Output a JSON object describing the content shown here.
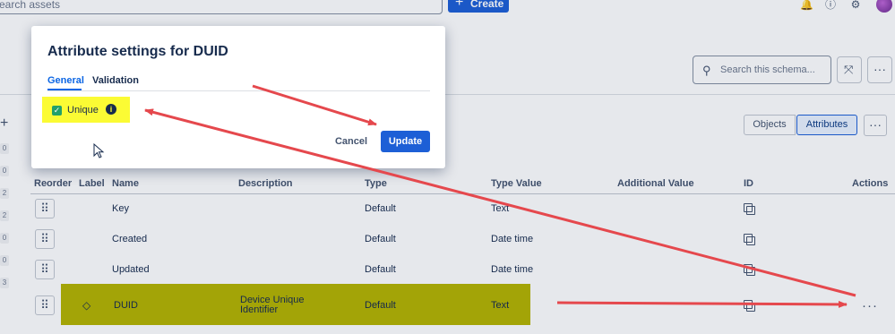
{
  "topbar": {
    "search_placeholder": "earch assets",
    "create_label": "Create",
    "create_icon": "plus-icon",
    "icons": [
      "bell-icon",
      "help-icon",
      "settings-icon",
      "avatar"
    ]
  },
  "left_rail": {
    "add_icon": "plus-icon",
    "numbers": [
      "0",
      "0",
      "2",
      "2",
      "0",
      "0",
      "3"
    ]
  },
  "header": {
    "schema_search_placeholder": "Search this schema...",
    "graph_icon": "graph-view-icon",
    "more_icon": "more-icon"
  },
  "view_toggle": {
    "objects_label": "Objects",
    "attributes_label": "Attributes"
  },
  "table": {
    "columns": [
      "Reorder",
      "Label",
      "Name",
      "Description",
      "Type",
      "Type Value",
      "Additional Value",
      "ID",
      "Actions"
    ],
    "rows": [
      {
        "name": "Key",
        "description": "",
        "type": "Default",
        "type_value": "Text",
        "has_label": false,
        "highlighted": false
      },
      {
        "name": "Created",
        "description": "",
        "type": "Default",
        "type_value": "Date time",
        "has_label": false,
        "highlighted": false
      },
      {
        "name": "Updated",
        "description": "",
        "type": "Default",
        "type_value": "Date time",
        "has_label": false,
        "highlighted": false
      },
      {
        "name": "DUID",
        "description": "Device Unique Identifier",
        "type": "Default",
        "type_value": "Text",
        "has_label": true,
        "highlighted": true
      }
    ],
    "row_actions_label": "···"
  },
  "modal": {
    "title": "Attribute settings for DUID",
    "tabs": [
      {
        "label": "General",
        "active": true
      },
      {
        "label": "Validation",
        "active": false
      }
    ],
    "unique_label": "Unique",
    "unique_checked": true,
    "info_icon": "info-icon",
    "cancel_label": "Cancel",
    "update_label": "Update"
  },
  "annotation_colors": {
    "highlight_yellow": "#fbfb34",
    "highlight_olive": "#b5b400",
    "arrow_red": "#e5484d"
  },
  "colors": {
    "primary": "#1d5fd6",
    "text": "#172b4d",
    "success": "#22a06b"
  }
}
